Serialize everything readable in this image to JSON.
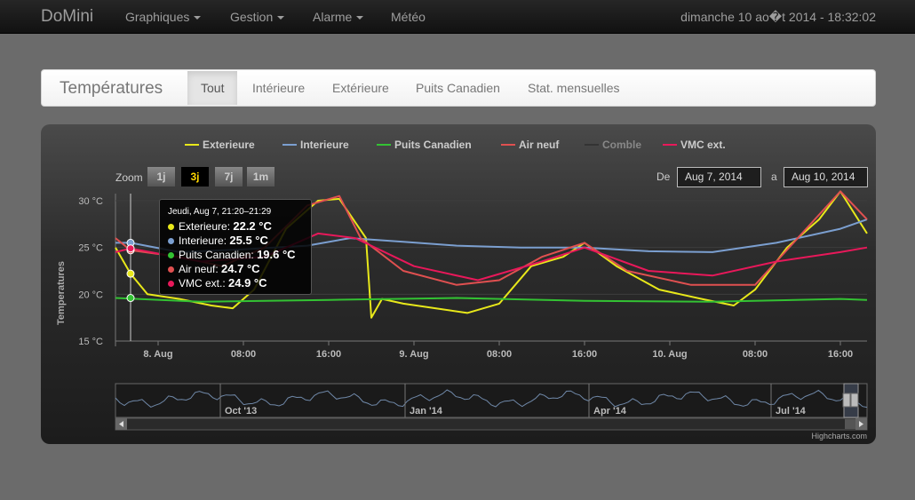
{
  "navbar": {
    "brand": "DoMini",
    "items": [
      {
        "label": "Graphiques",
        "dropdown": true
      },
      {
        "label": "Gestion",
        "dropdown": true
      },
      {
        "label": "Alarme",
        "dropdown": true
      },
      {
        "label": "Météo",
        "dropdown": false
      }
    ],
    "datetime": "dimanche 10 ao�t 2014 - 18:32:02"
  },
  "tabs": {
    "title": "Températures",
    "items": [
      {
        "label": "Tout",
        "active": true
      },
      {
        "label": "Intérieure",
        "active": false
      },
      {
        "label": "Extérieure",
        "active": false
      },
      {
        "label": "Puits Canadien",
        "active": false
      },
      {
        "label": "Stat. mensuelles",
        "active": false
      }
    ]
  },
  "range_selector": {
    "zoom_label": "Zoom",
    "buttons": [
      {
        "label": "1j",
        "active": false
      },
      {
        "label": "3j",
        "active": true
      },
      {
        "label": "7j",
        "active": false
      },
      {
        "label": "1m",
        "active": false
      }
    ],
    "from_label": "De",
    "from_value": "Aug 7, 2014",
    "to_label": "a",
    "to_value": "Aug 10, 2014"
  },
  "tooltip": {
    "header": "Jeudi, Aug 7, 21:20–21:29",
    "rows": [
      {
        "name": "Exterieure",
        "value": "22.2 °C",
        "color": "#e8e81a"
      },
      {
        "name": "Interieure",
        "value": "25.5 °C",
        "color": "#7b9fd0"
      },
      {
        "name": "Puits Canadien",
        "value": "19.6 °C",
        "color": "#33c233"
      },
      {
        "name": "Air neuf",
        "value": "24.7 °C",
        "color": "#e05050"
      },
      {
        "name": "VMC ext.",
        "value": "24.9 °C",
        "color": "#e8185a"
      }
    ]
  },
  "credits": "Highcharts.com",
  "chart_data": {
    "type": "line",
    "title": "",
    "ylabel": "Temperatures",
    "ylim": [
      15,
      30
    ],
    "y_ticks": [
      15,
      20,
      25,
      30
    ],
    "y_tick_labels": [
      "15 °C",
      "20 °C",
      "25 °C",
      "30 °C"
    ],
    "x_start": "2014-08-07 20:00",
    "x_end": "2014-08-10 18:30",
    "x_ticks": [
      "2014-08-08 00:00",
      "2014-08-08 08:00",
      "2014-08-08 16:00",
      "2014-08-09 00:00",
      "2014-08-09 08:00",
      "2014-08-09 16:00",
      "2014-08-10 00:00",
      "2014-08-10 08:00",
      "2014-08-10 16:00"
    ],
    "x_tick_labels": [
      "8. Aug",
      "08:00",
      "16:00",
      "9. Aug",
      "08:00",
      "16:00",
      "10. Aug",
      "08:00",
      "16:00"
    ],
    "grid": true,
    "legend": "top",
    "series": [
      {
        "name": "Exterieure",
        "color": "#e8e81a",
        "x": [
          "2014-08-07 20:00",
          "2014-08-07 21:25",
          "2014-08-07 23:00",
          "2014-08-08 02:00",
          "2014-08-08 05:00",
          "2014-08-08 07:00",
          "2014-08-08 09:00",
          "2014-08-08 12:00",
          "2014-08-08 15:00",
          "2014-08-08 17:00",
          "2014-08-08 19:30",
          "2014-08-08 20:00",
          "2014-08-08 21:00",
          "2014-08-08 23:00",
          "2014-08-09 02:00",
          "2014-08-09 05:00",
          "2014-08-09 08:00",
          "2014-08-09 11:00",
          "2014-08-09 14:00",
          "2014-08-09 16:00",
          "2014-08-09 19:00",
          "2014-08-09 23:00",
          "2014-08-10 03:00",
          "2014-08-10 06:00",
          "2014-08-10 08:00",
          "2014-08-10 11:00",
          "2014-08-10 14:00",
          "2014-08-10 16:00",
          "2014-08-10 18:30"
        ],
        "values": [
          25,
          22.2,
          20,
          19.5,
          18.8,
          18.5,
          20.5,
          27,
          30,
          30.2,
          26,
          17.5,
          19.5,
          19,
          18.5,
          18,
          19,
          23,
          24,
          25.5,
          23,
          20.5,
          19.5,
          18.8,
          20.5,
          25,
          28,
          31,
          26.5
        ]
      },
      {
        "name": "Interieure",
        "color": "#7b9fd0",
        "x": [
          "2014-08-07 20:00",
          "2014-08-07 21:25",
          "2014-08-08 02:00",
          "2014-08-08 08:00",
          "2014-08-08 14:00",
          "2014-08-08 18:00",
          "2014-08-08 23:00",
          "2014-08-09 04:00",
          "2014-08-09 10:00",
          "2014-08-09 16:00",
          "2014-08-09 22:00",
          "2014-08-10 04:00",
          "2014-08-10 10:00",
          "2014-08-10 16:00",
          "2014-08-10 18:30"
        ],
        "values": [
          25.5,
          25.5,
          24.5,
          24.8,
          25.2,
          26,
          25.6,
          25.2,
          25,
          25,
          24.6,
          24.5,
          25.5,
          27,
          28
        ]
      },
      {
        "name": "Puits Canadien",
        "color": "#33c233",
        "x": [
          "2014-08-07 20:00",
          "2014-08-08 04:00",
          "2014-08-08 16:00",
          "2014-08-09 04:00",
          "2014-08-09 16:00",
          "2014-08-10 04:00",
          "2014-08-10 16:00",
          "2014-08-10 18:30"
        ],
        "values": [
          19.6,
          19.2,
          19.4,
          19.6,
          19.3,
          19.2,
          19.5,
          19.4
        ]
      },
      {
        "name": "Air neuf",
        "color": "#e05050",
        "x": [
          "2014-08-07 20:00",
          "2014-08-07 21:25",
          "2014-08-08 02:00",
          "2014-08-08 06:00",
          "2014-08-08 10:00",
          "2014-08-08 14:00",
          "2014-08-08 17:00",
          "2014-08-08 19:00",
          "2014-08-08 23:00",
          "2014-08-09 04:00",
          "2014-08-09 08:00",
          "2014-08-09 12:00",
          "2014-08-09 16:00",
          "2014-08-09 20:00",
          "2014-08-10 02:00",
          "2014-08-10 08:00",
          "2014-08-10 12:00",
          "2014-08-10 16:00",
          "2014-08-10 18:30"
        ],
        "values": [
          26,
          24.7,
          24,
          23,
          25,
          29.5,
          30.5,
          26,
          22.5,
          21,
          21.5,
          24,
          25.5,
          22.5,
          21,
          21,
          26,
          31,
          28
        ]
      },
      {
        "name": "Comble",
        "color": "#333333",
        "x": [],
        "values": []
      },
      {
        "name": "VMC ext.",
        "color": "#e8185a",
        "x": [
          "2014-08-07 20:00",
          "2014-08-07 21:25",
          "2014-08-08 04:00",
          "2014-08-08 10:00",
          "2014-08-08 15:00",
          "2014-08-08 18:30",
          "2014-08-09 00:00",
          "2014-08-09 06:00",
          "2014-08-09 12:00",
          "2014-08-09 16:00",
          "2014-08-09 22:00",
          "2014-08-10 04:00",
          "2014-08-10 10:00",
          "2014-08-10 16:00",
          "2014-08-10 18:30"
        ],
        "values": [
          24.5,
          24.9,
          23.5,
          24,
          26.5,
          26,
          23,
          21.5,
          23.5,
          25,
          22.5,
          22,
          23.5,
          24.5,
          25
        ]
      }
    ],
    "navigator": {
      "tick_labels": [
        "Oct '13",
        "Jan '14",
        "Apr '14",
        "Jul '14"
      ],
      "series_name": "Exterieure"
    }
  }
}
